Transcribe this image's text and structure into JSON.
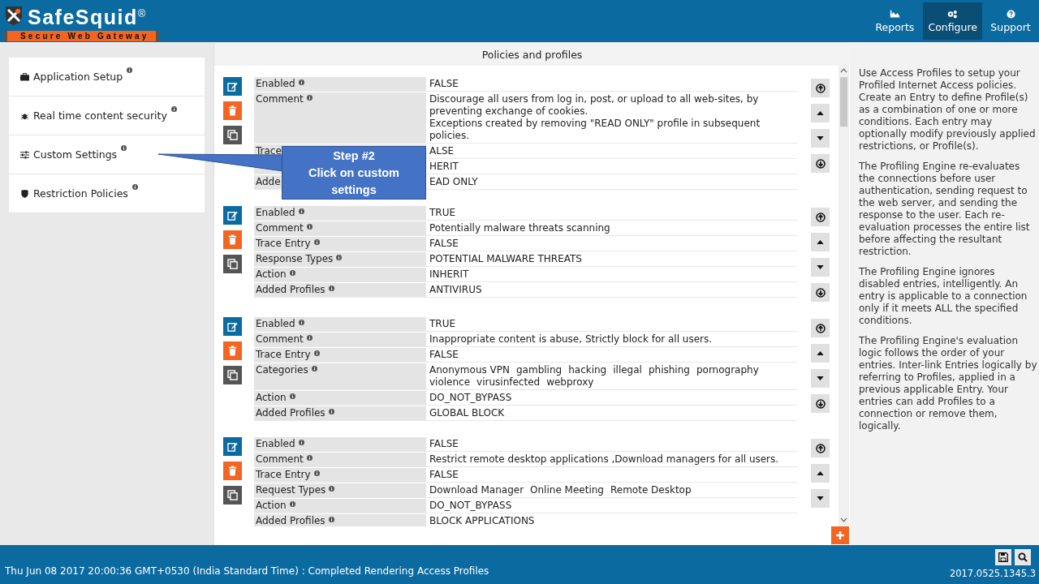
{
  "header": {
    "logo": "SafeSquid$^{®}$",
    "tagline": "Secure Web Gateway",
    "nav": [
      {
        "label": "Reports",
        "selected": false
      },
      {
        "label": "Configure",
        "selected": true
      },
      {
        "label": "Support",
        "selected": false
      }
    ]
  },
  "sidebar": {
    "items": [
      {
        "label": "Application Setup"
      },
      {
        "label": "Real time content security"
      },
      {
        "label": "Custom Settings"
      },
      {
        "label": "Restriction Policies"
      }
    ]
  },
  "main": {
    "title": "Policies and profiles",
    "entries": [
      {
        "rows": [
          {
            "label": "Enabled",
            "value": "FALSE"
          },
          {
            "label": "Comment",
            "lines": [
              "Discourage all users from log in, post, or upload to all web-sites, by preventing exchange of cookies.",
              "Exceptions created by removing \"READ ONLY\" profile in subsequent policies."
            ]
          },
          {
            "label": "Trace",
            "info": false,
            "value": "ALSE"
          },
          {
            "value": "HERIT"
          },
          {
            "label": "Adde",
            "info": false,
            "value": "EAD ONLY"
          }
        ]
      },
      {
        "rows": [
          {
            "label": "Enabled",
            "value": "TRUE"
          },
          {
            "label": "Comment",
            "value": "Potentially malware threats scanning"
          },
          {
            "label": "Trace Entry",
            "value": "FALSE"
          },
          {
            "label": "Response Types",
            "value": "POTENTIAL MALWARE THREATS"
          },
          {
            "label": "Action",
            "value": "INHERIT"
          },
          {
            "label": "Added Profiles",
            "value": "ANTIVIRUS"
          }
        ]
      },
      {
        "rows": [
          {
            "label": "Enabled",
            "value": "TRUE"
          },
          {
            "label": "Comment",
            "value": "Inappropriate content is abuse, Strictly block for all users."
          },
          {
            "label": "Trace Entry",
            "value": "FALSE"
          },
          {
            "label": "Categories",
            "tags": [
              "Anonymous VPN",
              "gambling",
              "hacking",
              "illegal",
              "phishing",
              "pornography",
              "violence",
              "virusinfected",
              "webproxy"
            ]
          },
          {
            "label": "Action",
            "value": "DO_NOT_BYPASS"
          },
          {
            "label": "Added Profiles",
            "value": "GLOBAL BLOCK"
          }
        ]
      },
      {
        "rows": [
          {
            "label": "Enabled",
            "value": "FALSE"
          },
          {
            "label": "Comment",
            "value": "Restrict remote desktop applications ,Download managers for all users."
          },
          {
            "label": "Trace Entry",
            "value": "FALSE"
          },
          {
            "label": "Request Types",
            "tags": [
              "Download Manager",
              "Online Meeting",
              "Remote Desktop"
            ]
          },
          {
            "label": "Action",
            "value": "DO_NOT_BYPASS"
          },
          {
            "label": "Added Profiles",
            "value": "BLOCK APPLICATIONS"
          }
        ]
      }
    ]
  },
  "help": [
    "Use Access Profiles to setup your Profiled Internet Access policies. Create an Entry to define Profile(s) as a combination of one or more conditions. Each entry may optionally modify previously applied restrictions, or Profile(s).",
    "The Profiling Engine re-evaluates the connections before user authentication, sending request to the web server, and sending the response to the user. Each re-evaluation processes the entire list before affecting the resultant restriction.",
    "The Profiling Engine ignores disabled entries, intelligently. An entry is applicable to a connection only if it meets ALL the specified conditions.",
    "The Profiling Engine's evaluation logic follows the order of your entries. Inter-link Entries logically by referring to Profiles, applied in a previous applicable Entry. Your entries can add Profiles to a connection or remove them, logically."
  ],
  "callout": {
    "title": "Step #2",
    "text": "Click on custom settings"
  },
  "status_bar": {
    "message": "Thu Jun 08 2017 20:00:36 GMT+0530 (India Standard Time) : Completed Rendering Access Profiles",
    "version": "2017.0525.1345.3"
  }
}
